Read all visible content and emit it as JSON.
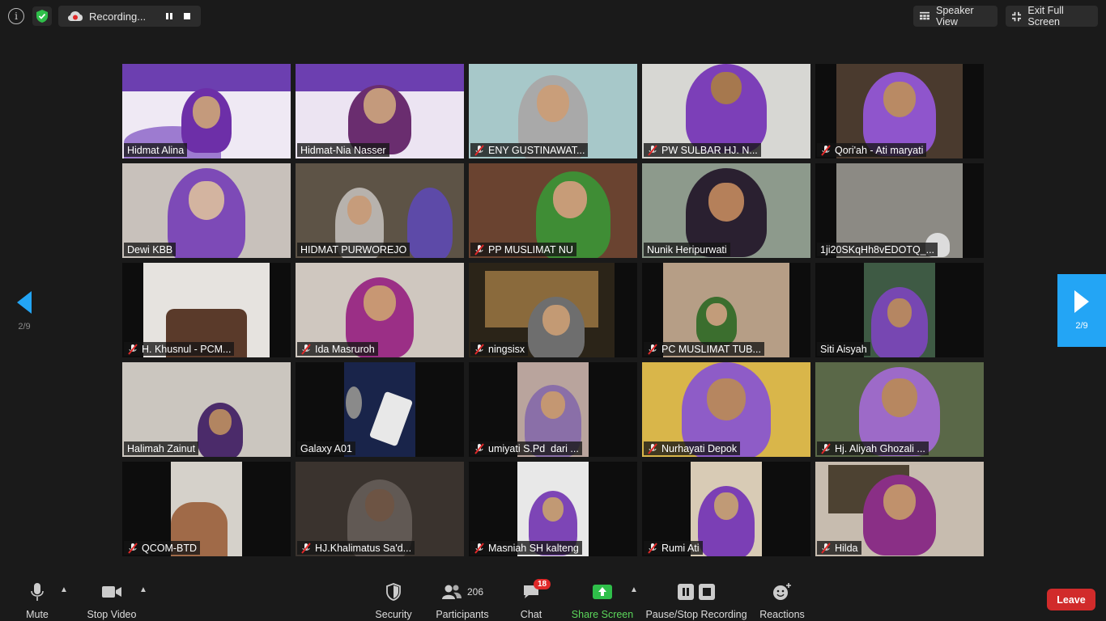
{
  "meeting": {
    "recording_status": "Recording...",
    "speaker_view_label": "Speaker View",
    "exit_fullscreen_label": "Exit Full Screen",
    "page_indicator": "2/9"
  },
  "colors": {
    "background": "#1a1a1a",
    "active_speaker_border": "#3adb3a",
    "page_next_bg": "#23a5f5",
    "leave_red": "#d12b2b",
    "share_green": "#5bd75b",
    "mute_red": "#e02828"
  },
  "participants": [
    {
      "name": "Hidmat Alina",
      "muted": false
    },
    {
      "name": "Hidmat-Nia Nasser",
      "muted": false,
      "active": true
    },
    {
      "name": "ENY GUSTINAWAT...",
      "muted": true
    },
    {
      "name": "PW SULBAR HJ. N...",
      "muted": true
    },
    {
      "name": "Qori'ah - Ati maryati",
      "muted": true
    },
    {
      "name": "Dewi KBB",
      "muted": false
    },
    {
      "name": "HIDMAT PURWOREJO",
      "muted": false
    },
    {
      "name": "PP MUSLIMAT NU",
      "muted": true
    },
    {
      "name": "Nunik Heripurwati",
      "muted": false
    },
    {
      "name": "1ji20SKqHh8vEDOTQ_...",
      "muted": false
    },
    {
      "name": "H. Khusnul - PCM...",
      "muted": true
    },
    {
      "name": "Ida Masruroh",
      "muted": true
    },
    {
      "name": "ningsisx",
      "muted": true
    },
    {
      "name": "PC MUSLIMAT TUB...",
      "muted": true
    },
    {
      "name": "Siti Aisyah",
      "muted": false
    },
    {
      "name": "Halimah Zainut",
      "muted": false
    },
    {
      "name": "Galaxy A01",
      "muted": false
    },
    {
      "name": "umiyati S.Pd  dari ...",
      "muted": true
    },
    {
      "name": "Nurhayati Depok",
      "muted": true
    },
    {
      "name": "Hj. Aliyah Ghozali ...",
      "muted": true
    },
    {
      "name": "QCOM-BTD",
      "muted": true
    },
    {
      "name": "HJ.Khalimatus Sa'd...",
      "muted": true
    },
    {
      "name": "Masniah SH kalteng",
      "muted": true
    },
    {
      "name": "Rumi Ati",
      "muted": true
    },
    {
      "name": "Hilda",
      "muted": true
    }
  ],
  "toolbar": {
    "mute_label": "Mute",
    "stop_video_label": "Stop Video",
    "security_label": "Security",
    "participants_label": "Participants",
    "participants_count": "206",
    "chat_label": "Chat",
    "chat_badge": "18",
    "share_screen_label": "Share Screen",
    "recording_label": "Pause/Stop Recording",
    "reactions_label": "Reactions",
    "leave_label": "Leave"
  },
  "icons": {
    "info": "info-icon",
    "shield": "shield-icon",
    "cloud_record": "cloud-record-icon",
    "pause": "pause-icon",
    "stop": "stop-icon",
    "grid_view": "grid-icon",
    "exit_fullscreen": "exit-fullscreen-icon",
    "prev_page": "triangle-left-icon",
    "next_page": "triangle-right-icon",
    "mic": "microphone-icon",
    "camera": "video-camera-icon",
    "participants": "people-icon",
    "chat": "chat-bubble-icon",
    "share": "share-arrow-icon",
    "reactions": "smiley-plus-icon"
  }
}
